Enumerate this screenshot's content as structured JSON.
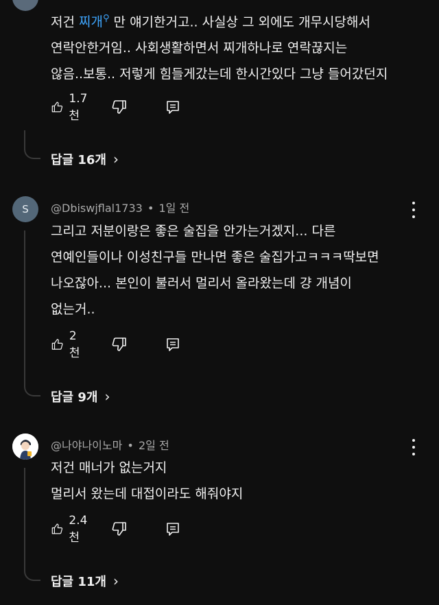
{
  "comments": [
    {
      "text_before_link": "저건 ",
      "link_text": "찌개",
      "search_icon": "magnifier-icon",
      "text_line1_after": "만 얘기한거고.. 사실상 그 외에도 개무시당해서",
      "text_line2": "연락안한거임.. 사회생활하면서 찌개하나로 연락끊지는",
      "text_line3": "않음..보통.. 저렇게 힘들게갔는데 한시간있다 그냥 들어갔던지",
      "likes": "1.7천",
      "replies_label": "답글 16개"
    },
    {
      "avatar_letter": "S",
      "author": "@Dbiswjflal1733",
      "time": "1일 전",
      "text_line1": "그리고 저분이랑은 좋은 술집을 안가는거겠지... 다른",
      "text_line2": "연예인들이나 이성친구들 만나면 좋은 술집가고ㅋㅋㅋ딱보면",
      "text_line3": "나오잖아... 본인이 불러서 멀리서 올라왔는데 걍 개념이",
      "text_line4": "없는거..",
      "likes": "2천",
      "replies_label": "답글 9개"
    },
    {
      "author": "@나야나이노마",
      "time": "2일 전",
      "text_line1": "저건 매너가 없는거지",
      "text_line2": "멀리서 왔는데 대접이라도 해줘야지",
      "likes": "2.4천",
      "replies_label": "답글 11개"
    }
  ],
  "separator": "•",
  "icons": {
    "like": "thumbs-up-icon",
    "dislike": "thumbs-down-icon",
    "reply": "reply-comment-icon",
    "menu": "more-vertical-icon",
    "expand": "chevron-right-icon"
  },
  "colors": {
    "background": "#0f0f0f",
    "link": "#3ea6ff",
    "text": "#f1f1f1",
    "meta": "#aaaaaa"
  }
}
